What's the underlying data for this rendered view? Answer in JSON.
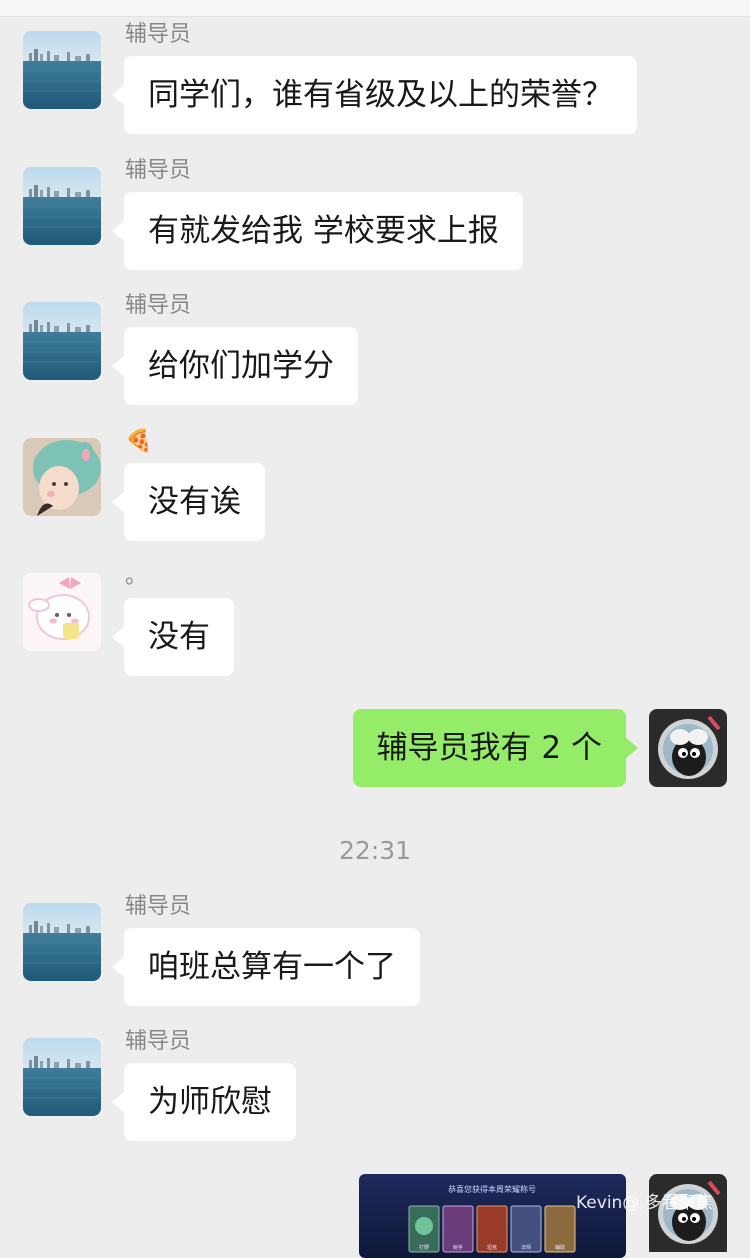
{
  "chat": {
    "messages": [
      {
        "sender": "辅导员",
        "text": "同学们，谁有省级及以上的荣誉？",
        "avatar_icon": "sea-skyline-avatar-icon"
      },
      {
        "sender": "辅导员",
        "text": "有就发给我 学校要求上报",
        "avatar_icon": "sea-skyline-avatar-icon"
      },
      {
        "sender": "辅导员",
        "text": "给你们加学分",
        "avatar_icon": "sea-skyline-avatar-icon"
      },
      {
        "sender": "🍕",
        "text": "没有诶",
        "avatar_icon": "girl-bunny-hat-avatar-icon"
      },
      {
        "sender": "。",
        "text": "没有",
        "avatar_icon": "pink-bunny-avatar-icon"
      },
      {
        "text": "辅导员我有 2 个",
        "avatar_icon": "shaun-sheep-avatar-icon"
      },
      {
        "sender": "辅导员",
        "text": "咱班总算有一个了",
        "avatar_icon": "sea-skyline-avatar-icon"
      },
      {
        "sender": "辅导员",
        "text": "为师欣慰",
        "avatar_icon": "sea-skyline-avatar-icon"
      }
    ],
    "timestamp": "22:31",
    "image_message": {
      "header": "恭喜您获得本周荣耀称号",
      "card_labels": [
        "打野",
        "射手",
        "坦克",
        "法师",
        "辅助"
      ],
      "icon": "game-honor-screenshot-icon"
    },
    "watermark": "Kevin@ 多看聚焦"
  }
}
